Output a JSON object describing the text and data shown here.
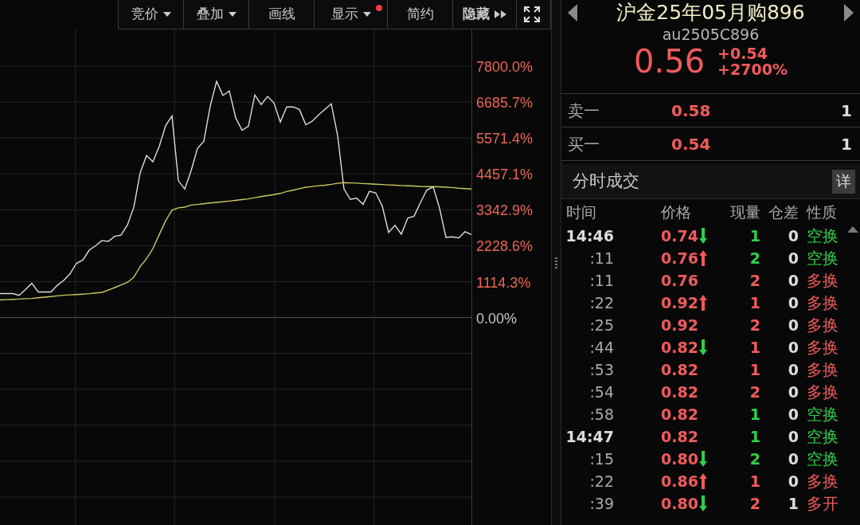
{
  "toolbar": [
    {
      "label": "竞价",
      "dropdown": true,
      "notification_dot": false,
      "kind": "menu"
    },
    {
      "label": "叠加",
      "dropdown": true,
      "notification_dot": false,
      "kind": "menu"
    },
    {
      "label": "画线",
      "dropdown": false,
      "notification_dot": false,
      "kind": "menu"
    },
    {
      "label": "显示",
      "dropdown": true,
      "notification_dot": true,
      "kind": "menu"
    },
    {
      "label": "简约",
      "dropdown": false,
      "notification_dot": false,
      "kind": "menu"
    },
    {
      "label": "隐藏",
      "dropdown": false,
      "notification_dot": false,
      "kind": "collapse"
    },
    {
      "kind": "fullscreen"
    }
  ],
  "chart": {
    "chart_data": {
      "type": "line",
      "grid": true,
      "ylim": [
        -6438,
        8939
      ],
      "yticks": [
        {
          "value": 0,
          "label": "0.00%"
        },
        {
          "value": 1114.3,
          "label": "1114.3%"
        },
        {
          "value": 2228.6,
          "label": "2228.6%"
        },
        {
          "value": 3342.9,
          "label": "3342.9%"
        },
        {
          "value": 4457.1,
          "label": "4457.1%"
        },
        {
          "value": 5571.4,
          "label": "5571.4%"
        },
        {
          "value": 6685.7,
          "label": "6685.7%"
        },
        {
          "value": 7800,
          "label": "7800.0%"
        }
      ],
      "categories": [
        null,
        null,
        null,
        null,
        null,
        null,
        null,
        null,
        null,
        null,
        null,
        null,
        null,
        null,
        null,
        null,
        null,
        null,
        null,
        null,
        null,
        null,
        null,
        null,
        null,
        null,
        null,
        null,
        null,
        null,
        null,
        null,
        null,
        null,
        null,
        null,
        null,
        null,
        null,
        null,
        null,
        null,
        null,
        null,
        null,
        null,
        null,
        null,
        null,
        null,
        null,
        null,
        null,
        null,
        null,
        null,
        null,
        null,
        null,
        null,
        null,
        null,
        null,
        null,
        null,
        null,
        null,
        null,
        null,
        null,
        null,
        null,
        null,
        null,
        null
      ],
      "series": [
        {
          "color": "#dcdcdc",
          "values": [
            743,
            743,
            743,
            690,
            867,
            1065,
            792,
            792,
            792,
            1000,
            1151,
            1362,
            1683,
            1783,
            2092,
            2228,
            2391,
            2362,
            2520,
            2557,
            2872,
            3417,
            4492,
            5026,
            4834,
            5309,
            5957,
            6256,
            4246,
            3986,
            4556,
            5249,
            5472,
            6561,
            7329,
            6893,
            7032,
            6197,
            5812,
            5940,
            6908,
            6611,
            6859,
            6661,
            6066,
            6537,
            6537,
            6456,
            5985,
            6091,
            6289,
            6463,
            6635,
            5645,
            3987,
            3665,
            3702,
            3513,
            3918,
            3863,
            3460,
            2642,
            2860,
            2585,
            3085,
            3145,
            3566,
            3957,
            4056,
            3392,
            2486,
            2507,
            2470,
            2663,
            2575
          ]
        },
        {
          "color": "#c9c860",
          "values": [
            545,
            555,
            565,
            574,
            585,
            594,
            612,
            632,
            652,
            673,
            693,
            703,
            713,
            726,
            742,
            760,
            782,
            851,
            930,
            1010,
            1089,
            1248,
            1583,
            1823,
            2140,
            2575,
            3000,
            3330,
            3405,
            3425,
            3491,
            3509,
            3532,
            3556,
            3574,
            3592,
            3614,
            3635,
            3660,
            3682,
            3720,
            3752,
            3784,
            3816,
            3852,
            3910,
            3953,
            3997,
            4045,
            4067,
            4090,
            4106,
            4134,
            4166,
            4184,
            4178,
            4169,
            4159,
            4148,
            4138,
            4127,
            4116,
            4105,
            4096,
            4088,
            4080,
            4070,
            4064,
            4061,
            4057,
            4043,
            4033,
            4015,
            4002,
            3987
          ]
        }
      ]
    }
  },
  "quote": {
    "name": "沪金25年05月购896",
    "code": "au2505C896",
    "price": "0.56",
    "change": "+0.54",
    "change_pct": "+2700%"
  },
  "order_book": [
    {
      "label": "卖一",
      "price": "0.58",
      "volume": "1"
    },
    {
      "label": "买一",
      "price": "0.54",
      "volume": "1"
    }
  ],
  "trades": {
    "title": "分时成交",
    "detail_button": "详",
    "columns": [
      "时间",
      "价格",
      "现量",
      "仓差",
      "性质"
    ],
    "rows": [
      {
        "time": "14:46",
        "kind": "minute",
        "price": "0.74",
        "up": false,
        "down": true,
        "volume": "1",
        "oi_change": "0",
        "nature": "空换",
        "color": "#2fcf4a"
      },
      {
        "time": ":11",
        "kind": "second",
        "price": "0.76",
        "up": true,
        "down": false,
        "volume": "2",
        "oi_change": "0",
        "nature": "空换",
        "color": "#2fcf4a"
      },
      {
        "time": ":11",
        "kind": "second",
        "price": "0.76",
        "up": false,
        "down": false,
        "volume": "2",
        "oi_change": "0",
        "nature": "多换",
        "color": "#f05a5c"
      },
      {
        "time": ":22",
        "kind": "second",
        "price": "0.92",
        "up": true,
        "down": false,
        "volume": "1",
        "oi_change": "0",
        "nature": "多换",
        "color": "#f05a5c"
      },
      {
        "time": ":25",
        "kind": "second",
        "price": "0.92",
        "up": false,
        "down": false,
        "volume": "2",
        "oi_change": "0",
        "nature": "多换",
        "color": "#f05a5c"
      },
      {
        "time": ":44",
        "kind": "second",
        "price": "0.82",
        "up": false,
        "down": true,
        "volume": "1",
        "oi_change": "0",
        "nature": "多换",
        "color": "#f05a5c"
      },
      {
        "time": ":53",
        "kind": "second",
        "price": "0.82",
        "up": false,
        "down": false,
        "volume": "1",
        "oi_change": "0",
        "nature": "多换",
        "color": "#f05a5c"
      },
      {
        "time": ":54",
        "kind": "second",
        "price": "0.82",
        "up": false,
        "down": false,
        "volume": "2",
        "oi_change": "0",
        "nature": "多换",
        "color": "#f05a5c"
      },
      {
        "time": ":58",
        "kind": "second",
        "price": "0.82",
        "up": false,
        "down": false,
        "volume": "1",
        "oi_change": "0",
        "nature": "空换",
        "color": "#2fcf4a"
      },
      {
        "time": "14:47",
        "kind": "minute",
        "price": "0.82",
        "up": false,
        "down": false,
        "volume": "1",
        "oi_change": "0",
        "nature": "空换",
        "color": "#2fcf4a"
      },
      {
        "time": ":15",
        "kind": "second",
        "price": "0.80",
        "up": false,
        "down": true,
        "volume": "2",
        "oi_change": "0",
        "nature": "空换",
        "color": "#2fcf4a"
      },
      {
        "time": ":22",
        "kind": "second",
        "price": "0.86",
        "up": true,
        "down": false,
        "volume": "1",
        "oi_change": "0",
        "nature": "多换",
        "color": "#f05a5c"
      },
      {
        "time": ":39",
        "kind": "second",
        "price": "0.80",
        "up": false,
        "down": true,
        "volume": "2",
        "oi_change": "1",
        "nature": "多开",
        "color": "#f05a5c"
      }
    ]
  }
}
